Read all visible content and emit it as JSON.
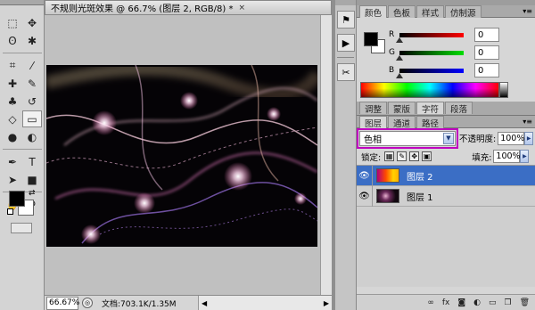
{
  "document": {
    "title": "不规则光斑效果 @ 66.7% (图层 2, RGB/8) *",
    "close_glyph": "×",
    "zoom": "66.67%",
    "doc_info": "文档:703.1K/1.35M"
  },
  "toolbox": {
    "foreground_color": "#000000",
    "background_color": "#ffffff",
    "tools": [
      "marquee-icon",
      "move-icon",
      "lasso-icon",
      "magic-wand-icon",
      "crop-icon",
      "eyedropper-icon",
      "healing-brush-icon",
      "brush-icon",
      "clone-stamp-icon",
      "history-brush-icon",
      "eraser-icon",
      "gradient-icon",
      "blur-icon",
      "dodge-icon",
      "pen-icon",
      "type-icon",
      "path-selection-icon",
      "shape-icon",
      "hand-icon",
      "zoom-icon"
    ]
  },
  "color_panel": {
    "tabs": [
      "颜色",
      "色板",
      "样式",
      "仿制源"
    ],
    "active_tab": "颜色",
    "channels": [
      {
        "label": "R",
        "value": "0",
        "color": "#e00000"
      },
      {
        "label": "G",
        "value": "0",
        "color": "#00b000"
      },
      {
        "label": "B",
        "value": "0",
        "color": "#0000e0"
      }
    ]
  },
  "adjust_panel": {
    "tabs": [
      "调整",
      "蒙版",
      "字符",
      "段落"
    ],
    "active_tab": "字符"
  },
  "layers_panel": {
    "tabs": [
      "图层",
      "通道",
      "路径"
    ],
    "active_tab": "图层",
    "blend_mode": "色相",
    "opacity_label": "不透明度:",
    "opacity": "100%",
    "lock_label": "锁定:",
    "fill_label": "填充:",
    "fill": "100%",
    "layers": [
      {
        "name": "图层 2",
        "selected": true,
        "visible": true
      },
      {
        "name": "图层 1",
        "selected": false,
        "visible": true
      }
    ]
  },
  "colors": {
    "selection_blue": "#3b6ec5",
    "highlight_magenta": "#c000c0"
  }
}
